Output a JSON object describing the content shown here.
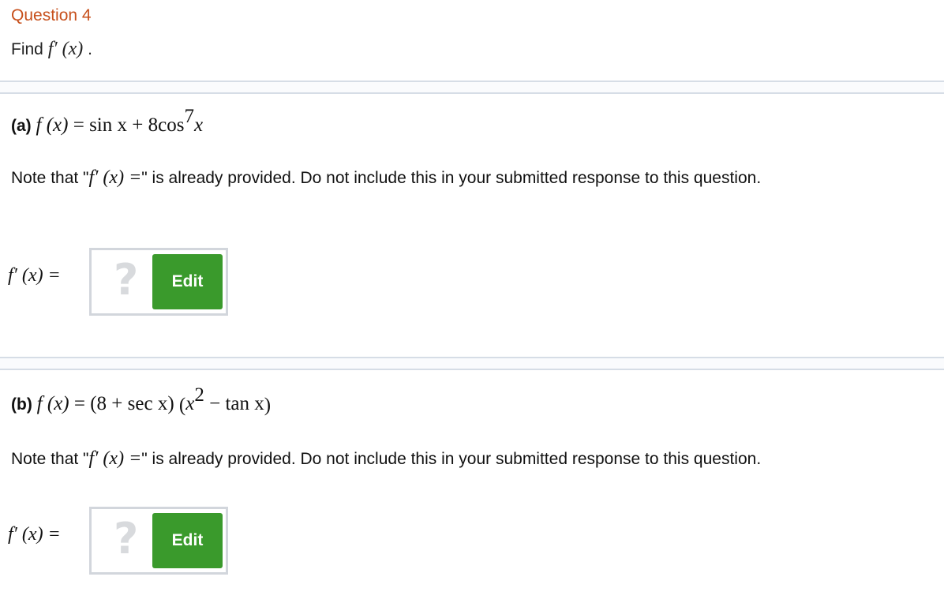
{
  "question": {
    "title": "Question 4",
    "find_prefix": "Find",
    "find_expr": "f′ (x)",
    "find_suffix": "."
  },
  "parts": [
    {
      "label": "(a)",
      "lhs": "f (x)",
      "eq": " = ",
      "rhs_a": "sin x + 8cos",
      "rhs_sup": "7",
      "rhs_b": "x",
      "note_pre": "Note that \"",
      "note_math": "f′ (x) =",
      "note_post": "\" is already provided. Do not include this in your submitted response to this question.",
      "answer_label": "f′ (x) =",
      "placeholder": "?",
      "edit_label": "Edit"
    },
    {
      "label": "(b)",
      "lhs": "f (x)",
      "eq": " = ",
      "rhs_a": "(8 + sec x) ",
      "rhs_paren_open": "(",
      "rhs_x": "x",
      "rhs_sup": "2",
      "rhs_b": " − tan x",
      "rhs_paren_close": ")",
      "note_pre": "Note that \"",
      "note_math": "f′ (x) =",
      "note_post": "\" is already provided. Do not include this in your submitted response to this question.",
      "answer_label": "f′ (x) =",
      "placeholder": "?",
      "edit_label": "Edit"
    }
  ]
}
